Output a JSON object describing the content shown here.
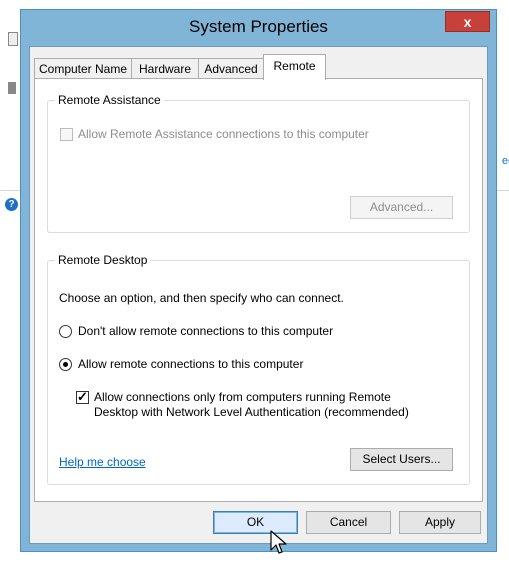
{
  "window": {
    "title": "System Properties",
    "close_label": "x"
  },
  "tabs": [
    {
      "label": "Computer Name",
      "active": false
    },
    {
      "label": "Hardware",
      "active": false
    },
    {
      "label": "Advanced",
      "active": false
    },
    {
      "label": "Remote",
      "active": true
    }
  ],
  "remote_assistance": {
    "group_label": "Remote Assistance",
    "checkbox_label": "Allow Remote Assistance connections to this computer",
    "checkbox_checked": false,
    "checkbox_enabled": false,
    "advanced_button": "Advanced..."
  },
  "remote_desktop": {
    "group_label": "Remote Desktop",
    "instruction": "Choose an option, and then specify who can connect.",
    "option_dont_allow": "Don't allow remote connections to this computer",
    "option_allow": "Allow remote connections to this computer",
    "selected_option": "allow",
    "nla_line1": "Allow connections only from computers running Remote",
    "nla_line2": "Desktop with Network Level Authentication (recommended)",
    "nla_checked": true,
    "help_link": "Help me choose",
    "select_users_button": "Select Users..."
  },
  "footer": {
    "ok": "OK",
    "cancel": "Cancel",
    "apply": "Apply"
  },
  "background": {
    "help_icon_glyph": "?",
    "partial_text": "ec"
  },
  "icons": {
    "close": "close-icon",
    "help": "help-icon",
    "cursor": "mouse-pointer-icon",
    "check": "checkmark-icon"
  },
  "colors": {
    "title_bar": "#81b5d8",
    "close_button": "#c7413a",
    "link": "#0066cc",
    "default_button": "#dcecfc"
  }
}
